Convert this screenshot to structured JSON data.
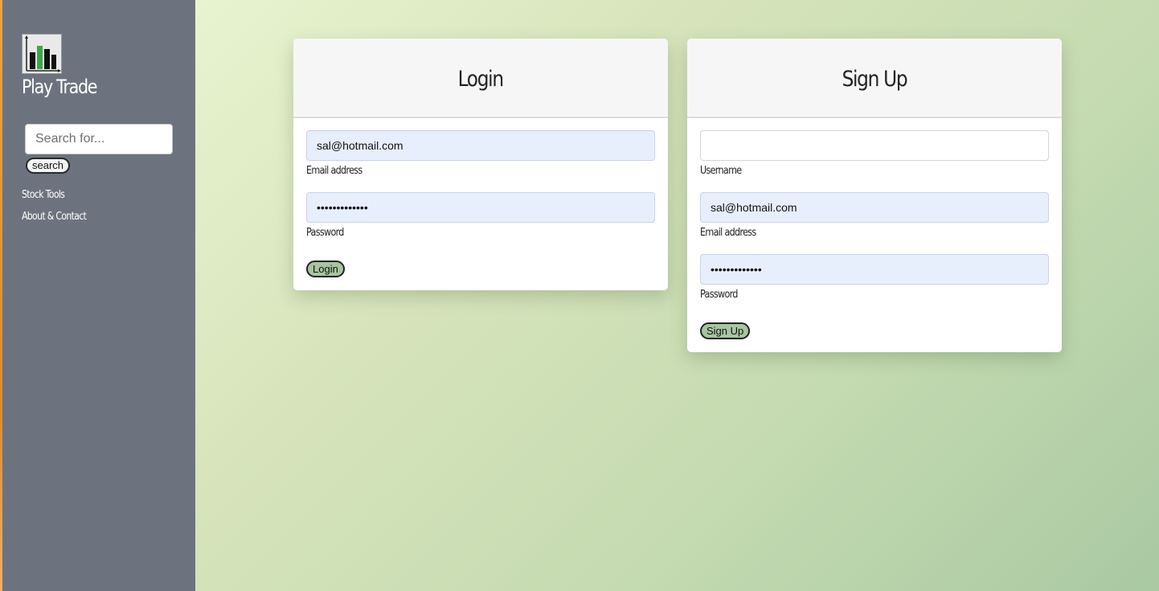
{
  "app": {
    "brand": "Play Trade",
    "logo_icon": "bar-chart-icon"
  },
  "sidebar": {
    "search": {
      "placeholder": "Search for...",
      "value": "",
      "button_label": "search"
    },
    "links": [
      {
        "label": "Stock Tools"
      },
      {
        "label": "About & Contact"
      }
    ]
  },
  "login": {
    "title": "Login",
    "email": {
      "value": "sal@hotmail.com",
      "label": "Email address"
    },
    "password": {
      "value": "•••••••••••••",
      "label": "Password"
    },
    "button_label": "Login"
  },
  "signup": {
    "title": "Sign Up",
    "username": {
      "value": "",
      "label": "Username"
    },
    "email": {
      "value": "sal@hotmail.com",
      "label": "Email address"
    },
    "password": {
      "value": "•••••••••••••",
      "label": "Password"
    },
    "button_label": "Sign Up"
  },
  "colors": {
    "sidebar": "#6c737e",
    "button_green": "#a7c59e",
    "autofill_blue": "#e8effc",
    "logo_bar_green": "#3aa64a"
  }
}
